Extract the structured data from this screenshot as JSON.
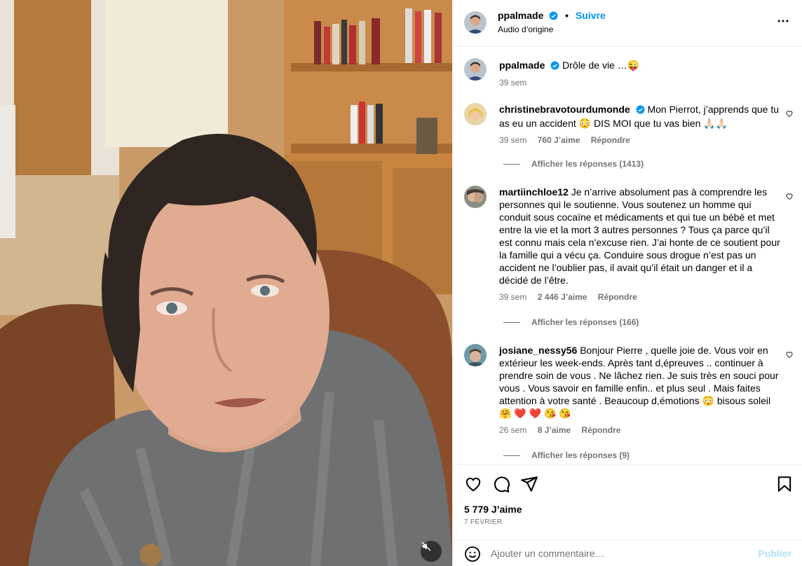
{
  "post": {
    "author": "ppalmade",
    "follow_label": "Suivre",
    "dot": "•",
    "audio_label": "Audio d’origine",
    "caption": "Drôle de vie …😜",
    "caption_time": "39 sem",
    "likes": "5 779 J’aime",
    "date": "7 FÉVRIER"
  },
  "comments": [
    {
      "username": "christinebravotourdumonde",
      "verified": true,
      "text": "Mon Pierrot, j’apprends que tu as eu un accident 😳 DIS MOI que tu vas bien 🙏🏻🙏🏻",
      "time": "39 sem",
      "likes": "760 J’aime",
      "reply_label": "Répondre",
      "view_replies": "Afficher les réponses (1413)"
    },
    {
      "username": "martiinchloe12",
      "verified": false,
      "text": "Je n’arrive absolument pas à comprendre les personnes qui le soutienne. Vous soutenez un homme qui conduit sous cocaïne et médicaments et qui tue un bébé et met entre la vie et la mort 3 autres personnes ? Tous ça parce qu’il est connu mais cela n’excuse rien. J’ai honte de ce soutient pour la famille qui a vécu ça. Conduire sous drogue n’est pas un accident ne l’oublier pas, il avait qu’il était un danger et il a décidé de l’être.",
      "time": "39 sem",
      "likes": "2 446 J’aime",
      "reply_label": "Répondre",
      "view_replies": "Afficher les réponses (166)"
    },
    {
      "username": "josiane_nessy56",
      "verified": false,
      "text": "Bonjour Pierre , quelle joie de. Vous voir en extérieur les week-ends. Après tant d,épreuves .. continuer à prendre soin de vous . Ne lâchez rien. Je suis très en souci pour vous . Vous savoir en famille enfin.. et plus seul . Mais faites attention à votre santé . Beaucoup d,émotions 😳 bisous soleil 🤗 ❤️ ❤️ 😘 😘",
      "time": "26 sem",
      "likes": "8 J’aime",
      "reply_label": "Répondre",
      "view_replies": "Afficher les réponses (9)"
    }
  ],
  "add_comment": {
    "placeholder": "Ajouter un commentaire…",
    "publish_label": "Publier"
  },
  "icons": {
    "more": "more-horizontal-icon",
    "like": "heart-icon",
    "comment": "comment-bubble-icon",
    "share": "paper-plane-icon",
    "save": "bookmark-icon",
    "emoji": "smiley-icon",
    "mute": "speaker-muted-icon",
    "verified": "verified-badge-icon"
  },
  "colors": {
    "accent": "#0095f6",
    "muted": "#737373",
    "publish_disabled": "#b2dffc",
    "divider": "#efefef"
  }
}
